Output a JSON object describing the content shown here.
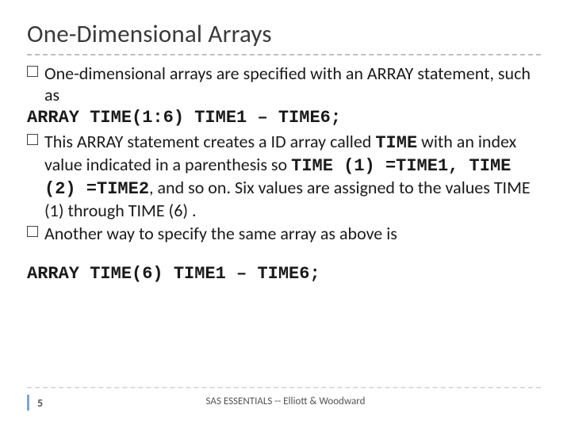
{
  "title": "One-Dimensional Arrays",
  "bullets": {
    "b1_a": "One-dimensional arrays are specified with an ARRAY statement, such as",
    "code1": "ARRAY TIME(1:6) TIME1 – TIME6;",
    "b2_a": "This ARRAY statement creates a ID array called ",
    "b2_time": "TIME",
    "b2_b": " with an index value indicated in a parenthesis so ",
    "b2_c1": "TIME (1) =TIME1, TIME (2) =TIME2",
    "b2_c": ", and so on. Six values are assigned to the values TIME (1) through TIME (6) .",
    "b3": "Another way to specify the same array as above is",
    "code2": "ARRAY TIME(6) TIME1 – TIME6;"
  },
  "footer": {
    "page": "5",
    "text": "SAS ESSENTIALS -- Elliott & Woodward"
  }
}
